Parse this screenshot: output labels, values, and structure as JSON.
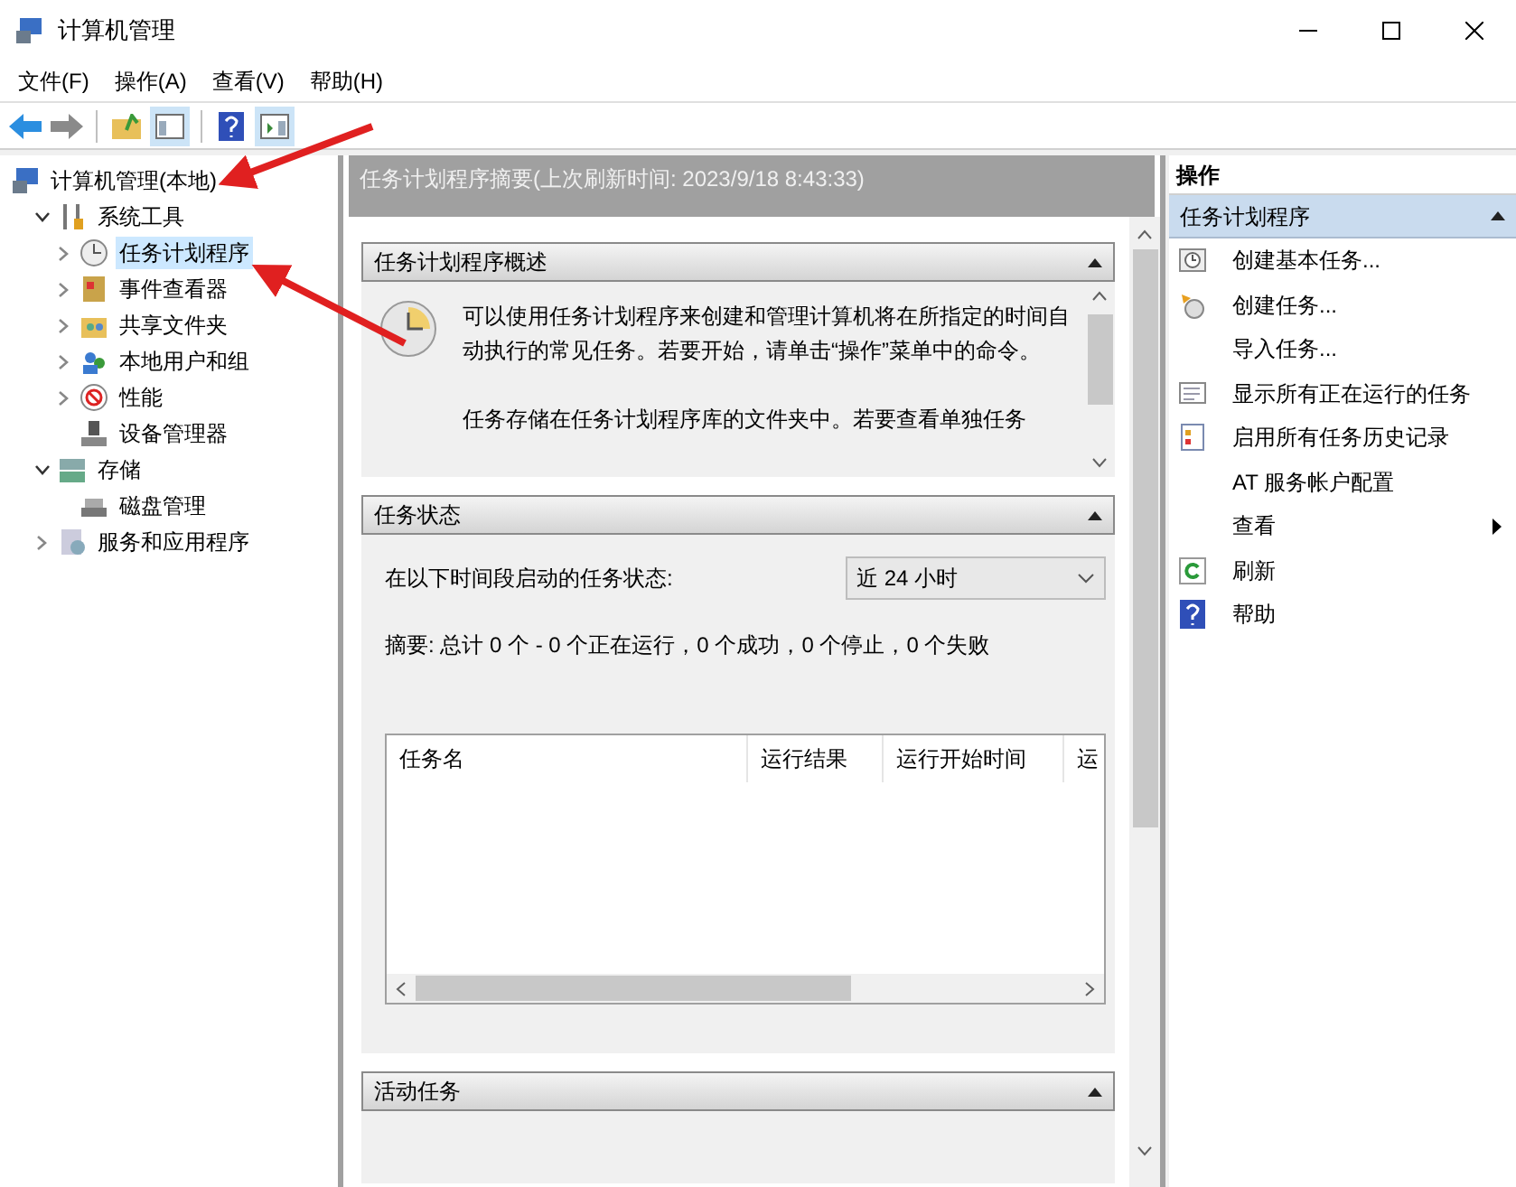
{
  "window": {
    "title": "计算机管理"
  },
  "menu": [
    "文件(F)",
    "操作(A)",
    "查看(V)",
    "帮助(H)"
  ],
  "tree": [
    {
      "label": "计算机管理(本地)",
      "selected": false,
      "children": [
        {
          "label": "系统工具",
          "selected": false,
          "expanded": true,
          "children": [
            {
              "label": "任务计划程序",
              "selected": true,
              "expanded": false
            },
            {
              "label": "事件查看器",
              "selected": false,
              "expanded": false
            },
            {
              "label": "共享文件夹",
              "selected": false,
              "expanded": false
            },
            {
              "label": "本地用户和组",
              "selected": false,
              "expanded": false
            },
            {
              "label": "性能",
              "selected": false,
              "expanded": false
            },
            {
              "label": "设备管理器",
              "selected": false
            }
          ]
        },
        {
          "label": "存储",
          "selected": false,
          "expanded": true,
          "children": [
            {
              "label": "磁盘管理",
              "selected": false
            }
          ]
        },
        {
          "label": "服务和应用程序",
          "selected": false,
          "expanded": false
        }
      ]
    }
  ],
  "summary_header": "任务计划程序摘要(上次刷新时间: 2023/9/18 8:43:33)",
  "overview": {
    "title": "任务计划程序概述",
    "expanded": true,
    "paragraphs": [
      "可以使用任务计划程序来创建和管理计算机将在所指定的时间自动执行的常见任务。若要开始，请单击“操作”菜单中的命令。",
      "任务存储在任务计划程序库的文件夹中。若要查看单独任务"
    ]
  },
  "task_status": {
    "title": "任务状态",
    "expanded": true,
    "period_label": "在以下时间段启动的任务状态:",
    "period_value": "近 24 小时",
    "summary": "摘要: 总计 0 个 - 0 个正在运行，0 个成功，0 个停止，0 个失败",
    "columns": [
      "任务名",
      "运行结果",
      "运行开始时间",
      "运"
    ]
  },
  "active_tasks": {
    "title": "活动任务",
    "expanded": true
  },
  "actions": {
    "title": "操作",
    "section": {
      "label": "任务计划程序",
      "expanded": true
    },
    "items": [
      {
        "label": "创建基本任务...",
        "kind": "wizard"
      },
      {
        "label": "创建任务...",
        "kind": "task"
      },
      {
        "label": "导入任务...",
        "kind": "plain"
      },
      {
        "label": "显示所有正在运行的任务",
        "kind": "list"
      },
      {
        "label": "启用所有任务历史记录",
        "kind": "log"
      },
      {
        "label": "AT 服务帐户配置",
        "kind": "plain"
      },
      {
        "label": "查看",
        "kind": "submenu"
      },
      {
        "label": "刷新",
        "kind": "refresh"
      },
      {
        "label": "帮助",
        "kind": "help"
      }
    ]
  }
}
